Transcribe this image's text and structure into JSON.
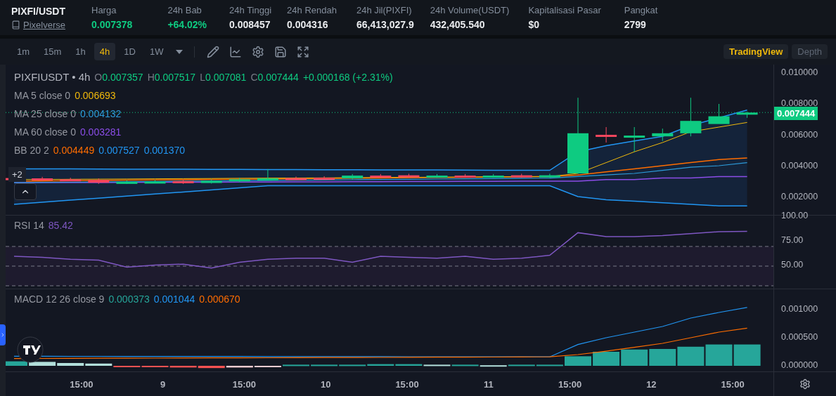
{
  "header": {
    "symbol": "PIXFI/USDT",
    "project": "Pixelverse",
    "stats": [
      {
        "label": "Harga",
        "value": "0.007378",
        "color": "#0ecb81"
      },
      {
        "label": "24h Bab",
        "value": "+64.02%",
        "color": "#0ecb81"
      },
      {
        "label": "24h Tinggi",
        "value": "0.008457",
        "color": "#eaecef"
      },
      {
        "label": "24h Rendah",
        "value": "0.004316",
        "color": "#eaecef"
      },
      {
        "label": "24h Jil(PIXFI)",
        "value": "66,413,027.9",
        "color": "#eaecef"
      },
      {
        "label": "24h Volume(USDT)",
        "value": "432,405.540",
        "color": "#eaecef"
      },
      {
        "label": "Kapitalisasi Pasar",
        "value": "$0",
        "color": "#eaecef"
      },
      {
        "label": "Pangkat",
        "value": "2799",
        "color": "#eaecef"
      }
    ]
  },
  "toolbar": {
    "intervals": [
      {
        "label": "1m",
        "selected": false
      },
      {
        "label": "15m",
        "selected": false
      },
      {
        "label": "1h",
        "selected": false
      },
      {
        "label": "4h",
        "selected": true
      },
      {
        "label": "1D",
        "selected": false
      },
      {
        "label": "1W",
        "selected": false
      }
    ],
    "views": [
      {
        "label": "TradingView",
        "selected": true
      },
      {
        "label": "Depth",
        "selected": false
      }
    ]
  },
  "chart": {
    "title": "PIXFIUSDT • 4h",
    "ohlc": [
      {
        "label": "O",
        "value": "0.007357"
      },
      {
        "label": "H",
        "value": "0.007517"
      },
      {
        "label": "L",
        "value": "0.007081"
      },
      {
        "label": "C",
        "value": "0.007444"
      }
    ],
    "change": "+0.000168 (+2.31%)",
    "indicators": [
      {
        "name": "MA 5 close 0",
        "values": [
          {
            "text": "0.006693",
            "color": "#f0b90b"
          }
        ]
      },
      {
        "name": "MA 25 close 0",
        "values": [
          {
            "text": "0.004132",
            "color": "#2d9cdb"
          }
        ]
      },
      {
        "name": "MA 60 close 0",
        "values": [
          {
            "text": "0.003281",
            "color": "#8b4de8"
          }
        ]
      },
      {
        "name": "BB 20 2",
        "values": [
          {
            "text": "0.004449",
            "color": "#ff6d00"
          },
          {
            "text": "0.007527",
            "color": "#2196f3"
          },
          {
            "text": "0.001370",
            "color": "#2196f3"
          }
        ]
      }
    ],
    "hidden_count": "+2",
    "price_axis": [
      "0.010000",
      "0.008000",
      "0.006000",
      "0.004000",
      "0.002000"
    ],
    "last_price": "0.007444",
    "rsi": {
      "name": "RSI 14",
      "value": "85.42",
      "axis": [
        "100.00",
        "75.00",
        "50.00"
      ]
    },
    "macd": {
      "name": "MACD 12 26 close 9",
      "values": [
        {
          "text": "0.000373",
          "color": "#26a69a"
        },
        {
          "text": "0.001044",
          "color": "#2196f3"
        },
        {
          "text": "0.000670",
          "color": "#ff6d00"
        }
      ],
      "axis": [
        "0.001000",
        "0.000500",
        "0.000000"
      ]
    },
    "time_axis": [
      "15:00",
      "9",
      "15:00",
      "10",
      "15:00",
      "11",
      "15:00",
      "12",
      "15:00"
    ]
  }
}
